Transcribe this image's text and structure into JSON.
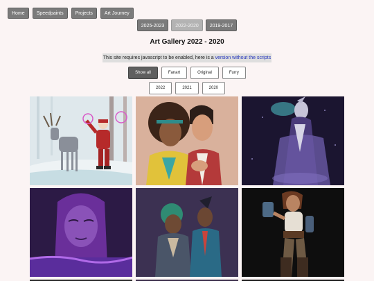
{
  "nav": {
    "items": [
      "Home",
      "Speedpaints",
      "Projects",
      "Art Journey"
    ]
  },
  "year_ranges": {
    "items": [
      "2025-2023",
      "2022-2020",
      "2019-2017"
    ],
    "active": "2022-2020"
  },
  "page_title": "Art Gallery 2022 - 2020",
  "notice": {
    "text": "This site requires javascript to be enabled, here is a ",
    "link": "version without the scripts"
  },
  "filters": {
    "category": [
      "Show all",
      "Fanart",
      "Original",
      "Furry"
    ],
    "years": [
      "2022",
      "2021",
      "2020"
    ],
    "active": "Show all"
  }
}
